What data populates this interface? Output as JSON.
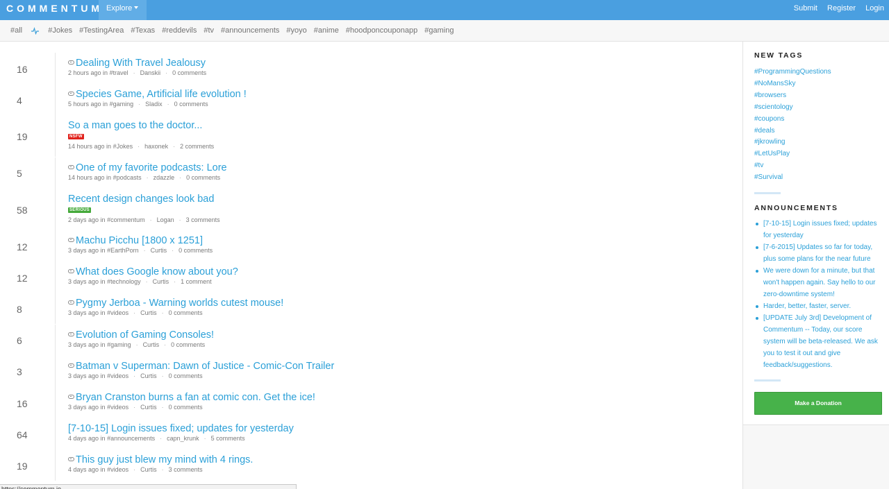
{
  "nav": {
    "logo": "COMMENTUM",
    "explore_label": "Explore",
    "submit_label": "Submit",
    "register_label": "Register",
    "login_label": "Login"
  },
  "tagbar": {
    "all": "#all",
    "pulse_icon": "pulse-icon",
    "tags": [
      "#Jokes",
      "#TestingArea",
      "#Texas",
      "#reddevils",
      "#tv",
      "#announcements",
      "#yoyo",
      "#anime",
      "#hoodponcouponapp",
      "#gaming"
    ]
  },
  "posts": [
    {
      "score": "16",
      "title": "Dealing With Travel Jealousy",
      "link": true,
      "badge": "",
      "time": "2 hours ago in",
      "tag": "#travel",
      "author": "Danskii",
      "comments": "0 comments"
    },
    {
      "score": "4",
      "title": "Species Game, Artificial life evolution !",
      "link": true,
      "badge": "",
      "time": "5 hours ago in",
      "tag": "#gaming",
      "author": "Sladix",
      "comments": "0 comments"
    },
    {
      "score": "19",
      "title": "So a man goes to the doctor...",
      "link": false,
      "badge": "NSFW",
      "time": "14 hours ago in",
      "tag": "#Jokes",
      "author": "haxonek",
      "comments": "2 comments"
    },
    {
      "score": "5",
      "title": "One of my favorite podcasts: Lore",
      "link": true,
      "badge": "",
      "time": "14 hours ago in",
      "tag": "#podcasts",
      "author": "zdazzle",
      "comments": "0 comments"
    },
    {
      "score": "58",
      "title": "Recent design changes look bad",
      "link": false,
      "badge": "SERIOUS",
      "time": "2 days ago in",
      "tag": "#commentum",
      "author": "Logan",
      "comments": "3 comments"
    },
    {
      "score": "12",
      "title": "Machu Picchu [1800 x 1251]",
      "link": true,
      "badge": "",
      "time": "3 days ago in",
      "tag": "#EarthPorn",
      "author": "Curtis",
      "comments": "0 comments"
    },
    {
      "score": "12",
      "title": "What does Google know about you?",
      "link": true,
      "badge": "",
      "time": "3 days ago in",
      "tag": "#technology",
      "author": "Curtis",
      "comments": "1 comment"
    },
    {
      "score": "8",
      "title": "Pygmy Jerboa - Warning worlds cutest mouse!",
      "link": true,
      "badge": "",
      "time": "3 days ago in",
      "tag": "#videos",
      "author": "Curtis",
      "comments": "0 comments"
    },
    {
      "score": "6",
      "title": "Evolution of Gaming Consoles!",
      "link": true,
      "badge": "",
      "time": "3 days ago in",
      "tag": "#gaming",
      "author": "Curtis",
      "comments": "0 comments"
    },
    {
      "score": "3",
      "title": "Batman v Superman: Dawn of Justice - Comic-Con Trailer",
      "link": true,
      "badge": "",
      "time": "3 days ago in",
      "tag": "#videos",
      "author": "Curtis",
      "comments": "0 comments"
    },
    {
      "score": "16",
      "title": "Bryan Cranston burns a fan at comic con. Get the ice!",
      "link": true,
      "badge": "",
      "time": "3 days ago in",
      "tag": "#videos",
      "author": "Curtis",
      "comments": "0 comments"
    },
    {
      "score": "64",
      "title": "[7-10-15] Login issues fixed; updates for yesterday",
      "link": false,
      "badge": "",
      "time": "4 days ago in",
      "tag": "#announcements",
      "author": "capn_krunk",
      "comments": "5 comments"
    },
    {
      "score": "19",
      "title": "This guy just blew my mind with 4 rings.",
      "link": true,
      "badge": "",
      "time": "4 days ago in",
      "tag": "#videos",
      "author": "Curtis",
      "comments": "3 comments"
    }
  ],
  "sidebar": {
    "new_tags_heading": "NEW TAGS",
    "new_tags": [
      "#ProgrammingQuestions",
      "#NoMansSky",
      "#browsers",
      "#scientology",
      "#coupons",
      "#deals",
      "#jkrowling",
      "#LetUsPlay",
      "#tv",
      "#Survival"
    ],
    "announcements_heading": "ANNOUNCEMENTS",
    "announcements": [
      "[7-10-15] Login issues fixed; updates for yesterday",
      "[7-6-2015] Updates so far for today, plus some plans for the near future",
      "We were down for a minute, but that won't happen again. Say hello to our zero-downtime system!",
      "Harder, better, faster, server.",
      "[UPDATE July 3rd] Development of Commentum -- Today, our score system will be beta-released. We ask you to test it out and give feedback/suggestions."
    ],
    "donate_label": "Make a Donation"
  },
  "statusbar": {
    "url": "https://commentum.io"
  },
  "colors": {
    "nav_bg": "#4a9fe0",
    "link": "#2ba0d8",
    "nsfw": "#e0211b",
    "serious": "#45a93a",
    "donate": "#47b24a"
  }
}
